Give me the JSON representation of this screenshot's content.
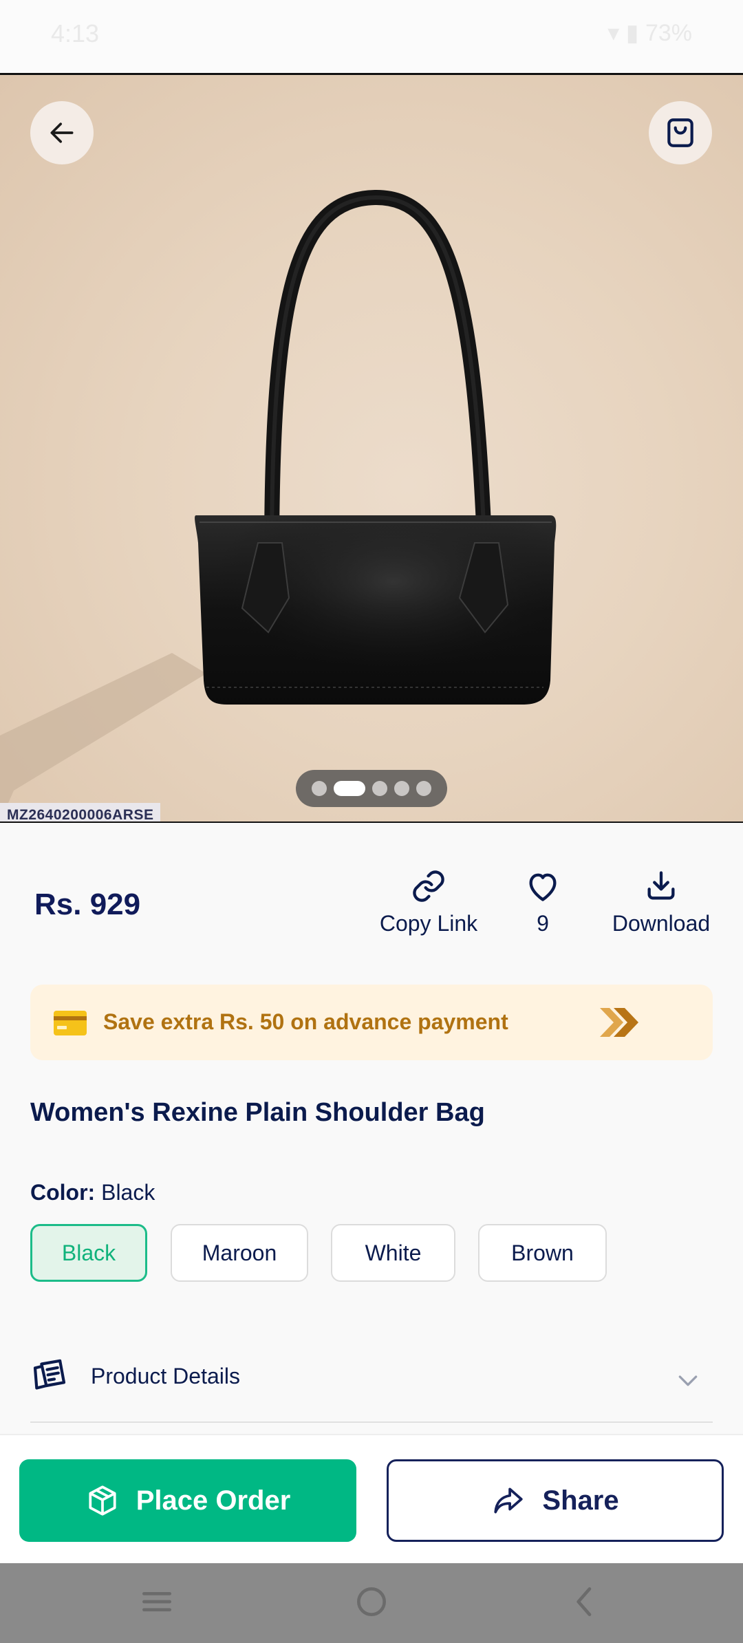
{
  "status_bar": {
    "time": "4:13",
    "right": "▾ ▮ 73%"
  },
  "product": {
    "sku": "MZ2640200006ARSE",
    "price": "Rs. 929",
    "title": "Women's Rexine Plain Shoulder Bag",
    "image_dots": {
      "count": 5,
      "active_index": 1
    }
  },
  "actions": {
    "copy_link_label": "Copy Link",
    "likes_count": "9",
    "download_label": "Download"
  },
  "promo": {
    "text": "Save extra Rs. 50 on advance payment"
  },
  "color": {
    "label": "Color:",
    "selected": "Black",
    "options": [
      "Black",
      "Maroon",
      "White",
      "Brown"
    ]
  },
  "details": {
    "label": "Product Details"
  },
  "bottom": {
    "place_order_label": "Place Order",
    "share_label": "Share"
  },
  "colors": {
    "accent": "#00b884",
    "navy": "#0b1b4d",
    "promo_text": "#b07211",
    "promo_bg": "#fff3e0"
  },
  "icons": [
    "back-arrow-icon",
    "shopping-bag-icon",
    "link-icon",
    "heart-icon",
    "download-icon",
    "credit-card-icon",
    "double-chevron-icon",
    "document-icon",
    "chevron-down-icon",
    "box-icon",
    "share-icon"
  ]
}
